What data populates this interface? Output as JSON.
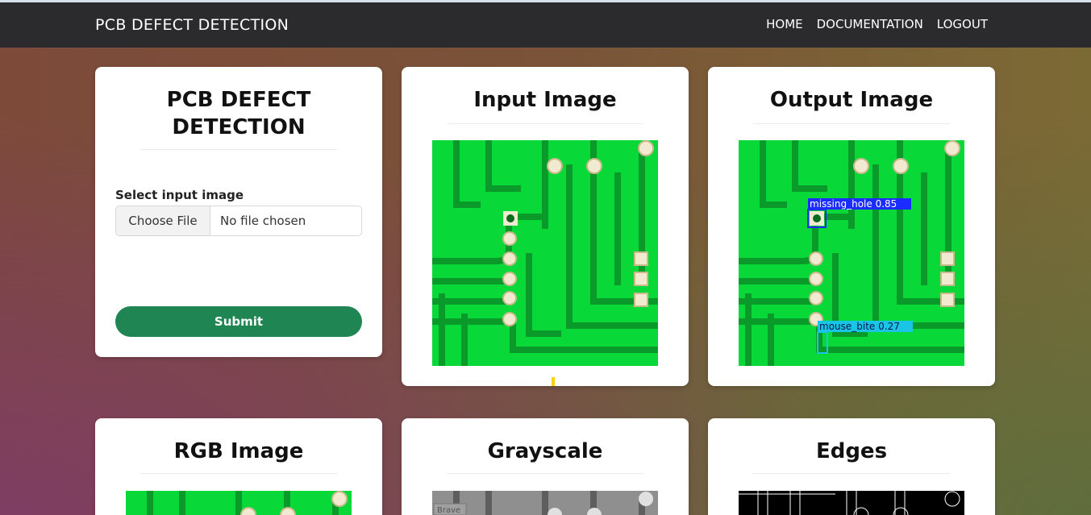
{
  "navbar": {
    "brand": "PCB DEFECT DETECTION",
    "links": [
      "HOME",
      "DOCUMENTATION",
      "LOGOUT"
    ]
  },
  "form_card": {
    "title_line1": "PCB DEFECT",
    "title_line2": "DETECTION",
    "field_label": "Select input image",
    "file_button": "Choose File",
    "file_status": "No file chosen",
    "submit_label": "Submit"
  },
  "cards": {
    "input_title": "Input Image",
    "output_title": "Output Image",
    "rgb_title": "RGB Image",
    "gray_title": "Grayscale",
    "edges_title": "Edges"
  },
  "detections": [
    {
      "label": "missing_hole 0.85",
      "color": "#1a2cff"
    },
    {
      "label": "mouse_bite 0.27",
      "color": "#19c4e6"
    }
  ],
  "grayscale_watermark": "Brave",
  "colors": {
    "pcb_green": "#08d838",
    "pcb_trace_dark": "#0a9a2a",
    "submit_green": "#1e8553",
    "navbar": "#2b2b2d"
  }
}
